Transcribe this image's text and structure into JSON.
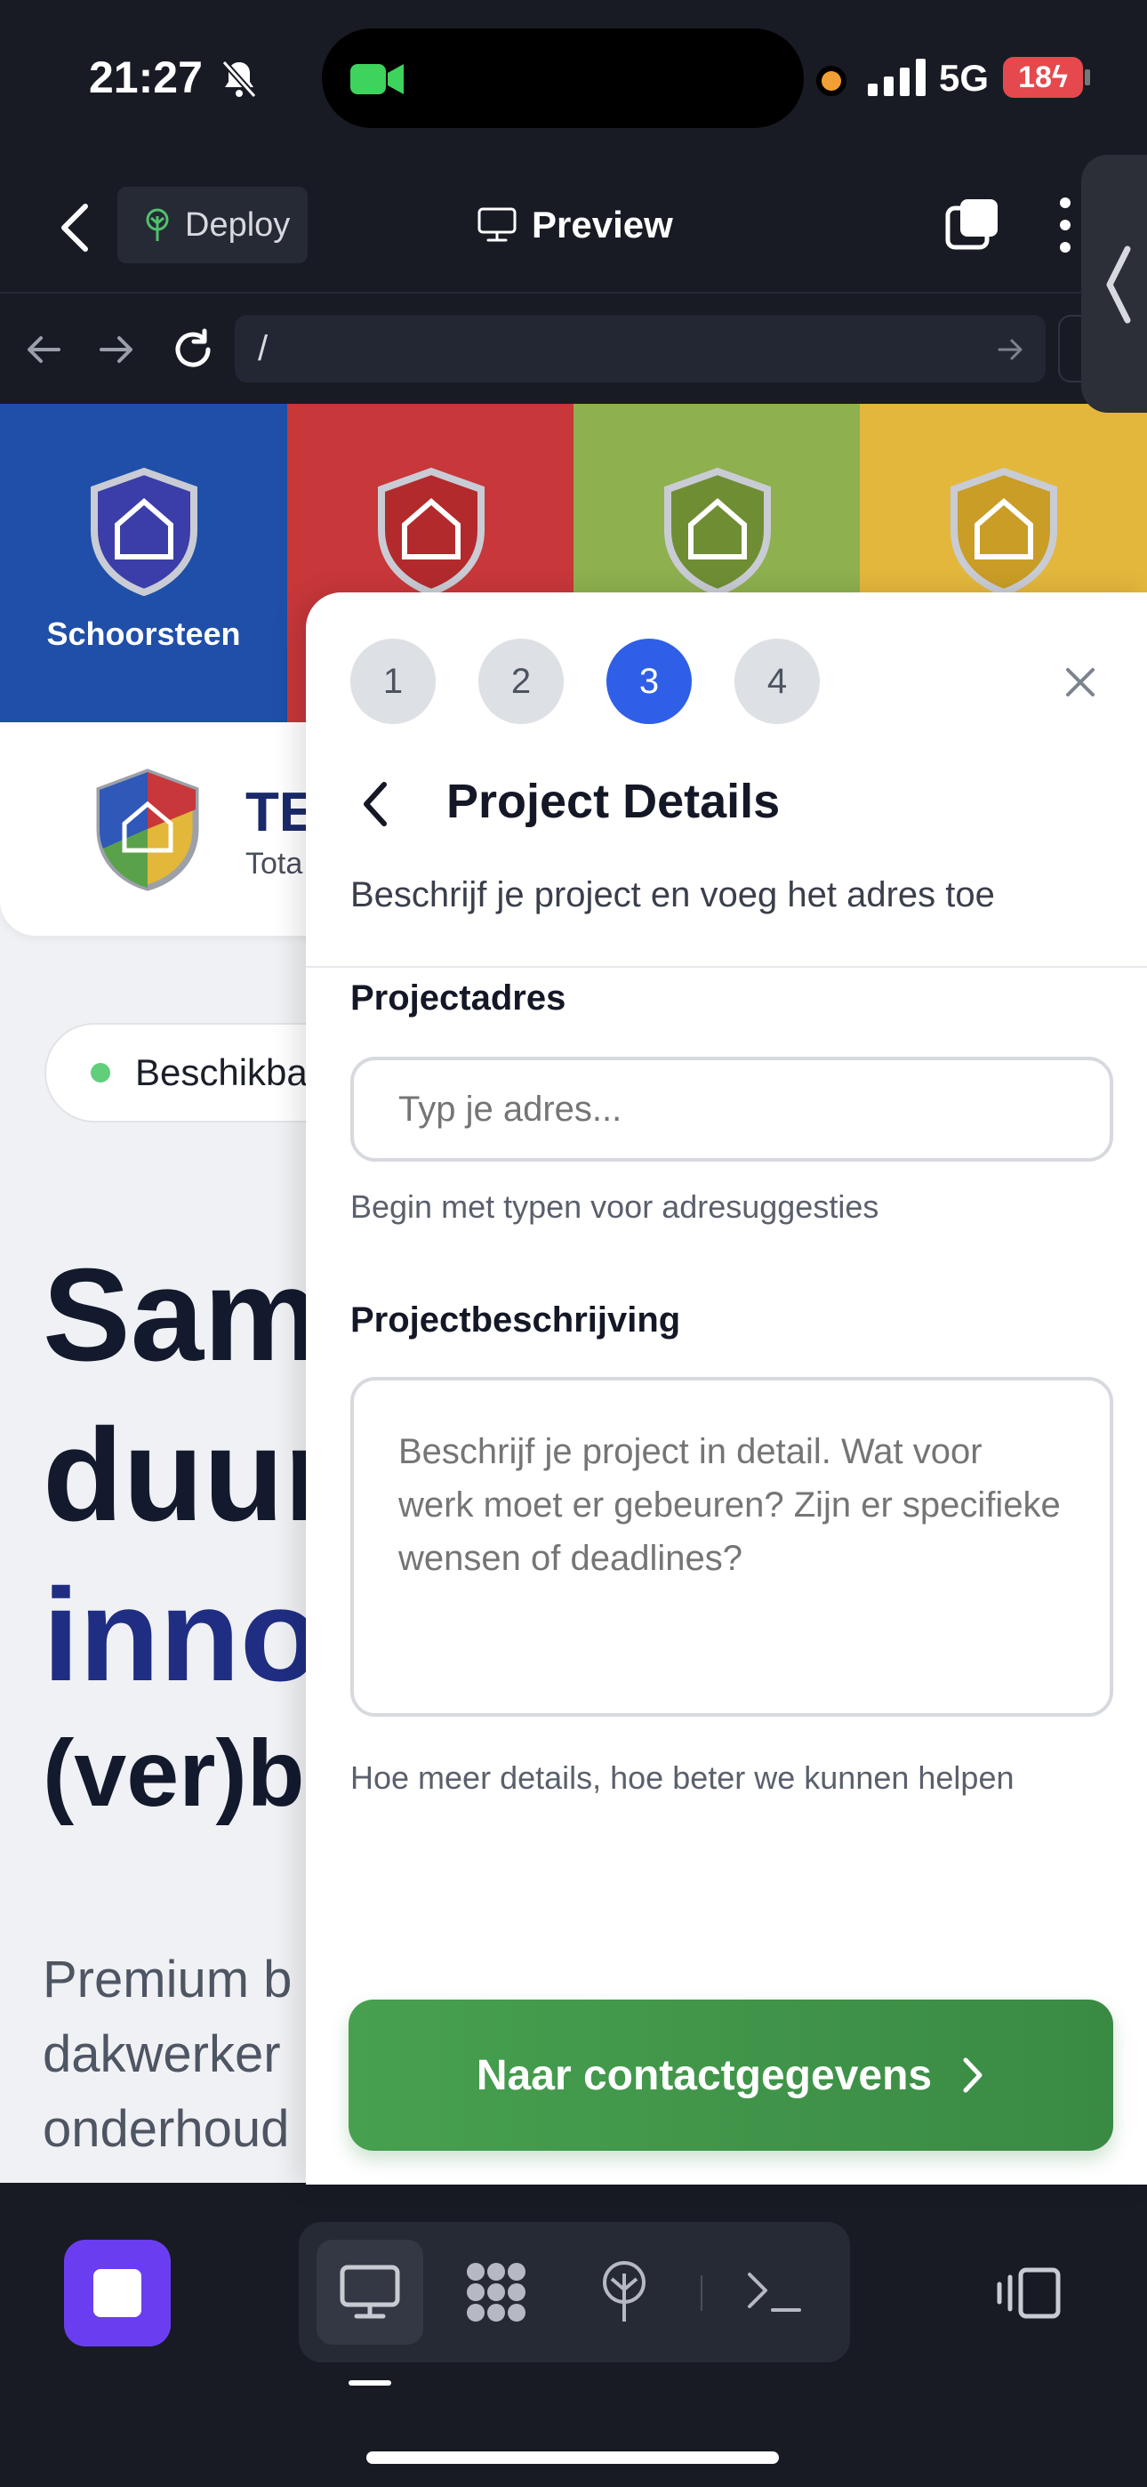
{
  "status_bar": {
    "time": "21:27",
    "network": "5G",
    "battery": "18"
  },
  "toolbar": {
    "deploy_label": "Deploy",
    "preview_label": "Preview"
  },
  "address_bar": {
    "url": "/"
  },
  "website": {
    "categories": [
      {
        "label": "Schoorsteen",
        "color": "#1f4fa8"
      },
      {
        "label": "",
        "color": "#c8373a"
      },
      {
        "label": "",
        "color": "#8eb04f"
      },
      {
        "label": "",
        "color": "#e3b73c"
      }
    ],
    "brand_name": "TE",
    "brand_sub": "Tota",
    "availability": "Beschikba",
    "hero_lines": [
      "Sam",
      "duur",
      "inno",
      "(ver)b"
    ],
    "lead_lines": [
      "Premium b",
      "dakwerker",
      "onderhoud"
    ]
  },
  "modal": {
    "steps": [
      "1",
      "2",
      "3",
      "4"
    ],
    "active_step": "3",
    "title": "Project Details",
    "subtitle": "Beschrijf je project en voeg het adres toe",
    "address_label": "Projectadres",
    "address_placeholder": "Typ je adres...",
    "address_hint": "Begin met typen voor adresuggesties",
    "description_label": "Projectbeschrijving",
    "description_placeholder": "Beschrijf je project in detail. Wat voor werk moet er gebeuren? Zijn er specifieke wensen of deadlines?",
    "description_hint": "Hoe meer details, hoe beter we kunnen helpen",
    "cta_label": "Naar contactgegevens"
  },
  "colors": {
    "accent_blue": "#2f5fe6",
    "cta_green": "#3f944a",
    "dock_purple": "#6a3ef0"
  },
  "dock": {
    "icons": [
      "stop-icon",
      "monitor-icon",
      "apps-icon",
      "deploy-tree-icon",
      "terminal-icon",
      "split-layout-icon"
    ]
  }
}
